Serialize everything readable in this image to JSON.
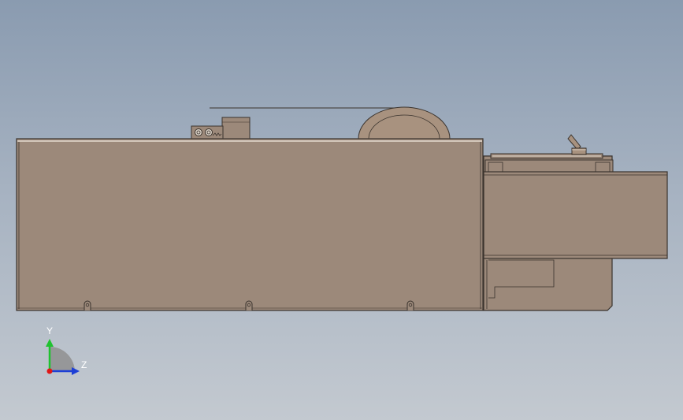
{
  "viewport": {
    "background_top": "#8a9bb0",
    "background_bottom": "#c3c9d0"
  },
  "model": {
    "body_color": "#9c897a",
    "edge_color": "#3a332d",
    "highlight_color": "#e6ddd2",
    "wheel_color": "#a8927f"
  },
  "triad": {
    "y_label": "Y",
    "z_label": "Z",
    "y_color": "#1fc22f",
    "z_color": "#1d3fd6",
    "x_color": "#e01616",
    "sector_color": "#8f8f8f"
  }
}
